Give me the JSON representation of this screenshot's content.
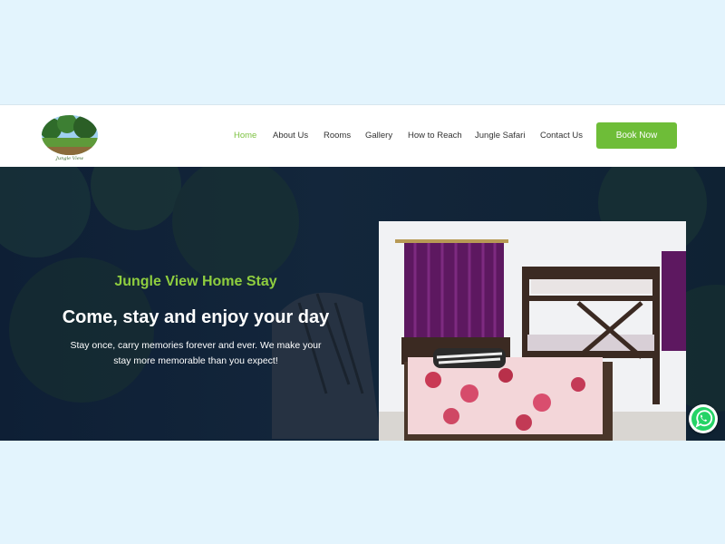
{
  "nav": {
    "logo_text": "Jungle View",
    "links": [
      {
        "label": "Home",
        "active": true
      },
      {
        "label": "About Us",
        "active": false
      },
      {
        "label": "Rooms",
        "active": false
      },
      {
        "label": "Gallery",
        "active": false
      },
      {
        "label": "How to Reach",
        "active": false
      },
      {
        "label": "Jungle Safari",
        "active": false
      },
      {
        "label": "Contact Us",
        "active": false
      }
    ],
    "cta_label": "Book Now"
  },
  "hero": {
    "tagline": "Jungle View Home Stay",
    "title": "Come, stay and enjoy your day",
    "description": "Stay once, carry memories forever and ever. We make your stay more memorable than you expect!"
  },
  "floating": {
    "icon": "whatsapp-icon"
  },
  "colors": {
    "accent": "#6ebd38",
    "accent_text": "#8fce3f",
    "hero_bg": "#13263b",
    "page_bg": "#e3f4fd"
  }
}
